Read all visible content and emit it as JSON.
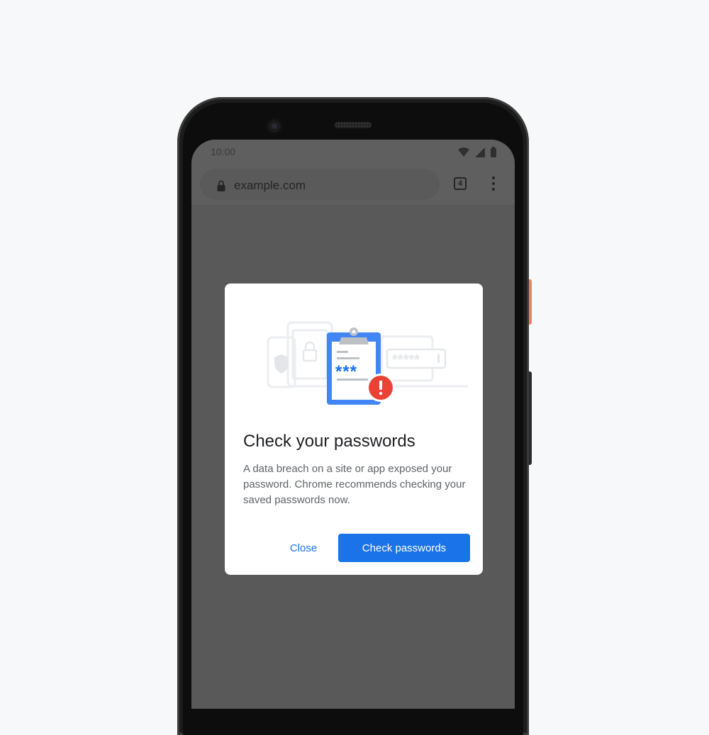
{
  "status_bar": {
    "time": "10:00",
    "icons": [
      "wifi-icon",
      "signal-icon",
      "battery-icon"
    ]
  },
  "toolbar": {
    "url": "example.com",
    "tab_count": "4",
    "icons": [
      "lock-icon",
      "tab-switcher-icon",
      "more-vert-icon"
    ]
  },
  "dialog": {
    "illustration_text": "*** ",
    "title": "Check your passwords",
    "body": "A data breach on a site or app exposed your password. Chrome recommends checking your saved passwords now.",
    "close_label": "Close",
    "check_label": "Check passwords",
    "colors": {
      "accent": "#1a73e8",
      "alert": "#ea4335",
      "clipboard": "#4285f4"
    }
  }
}
